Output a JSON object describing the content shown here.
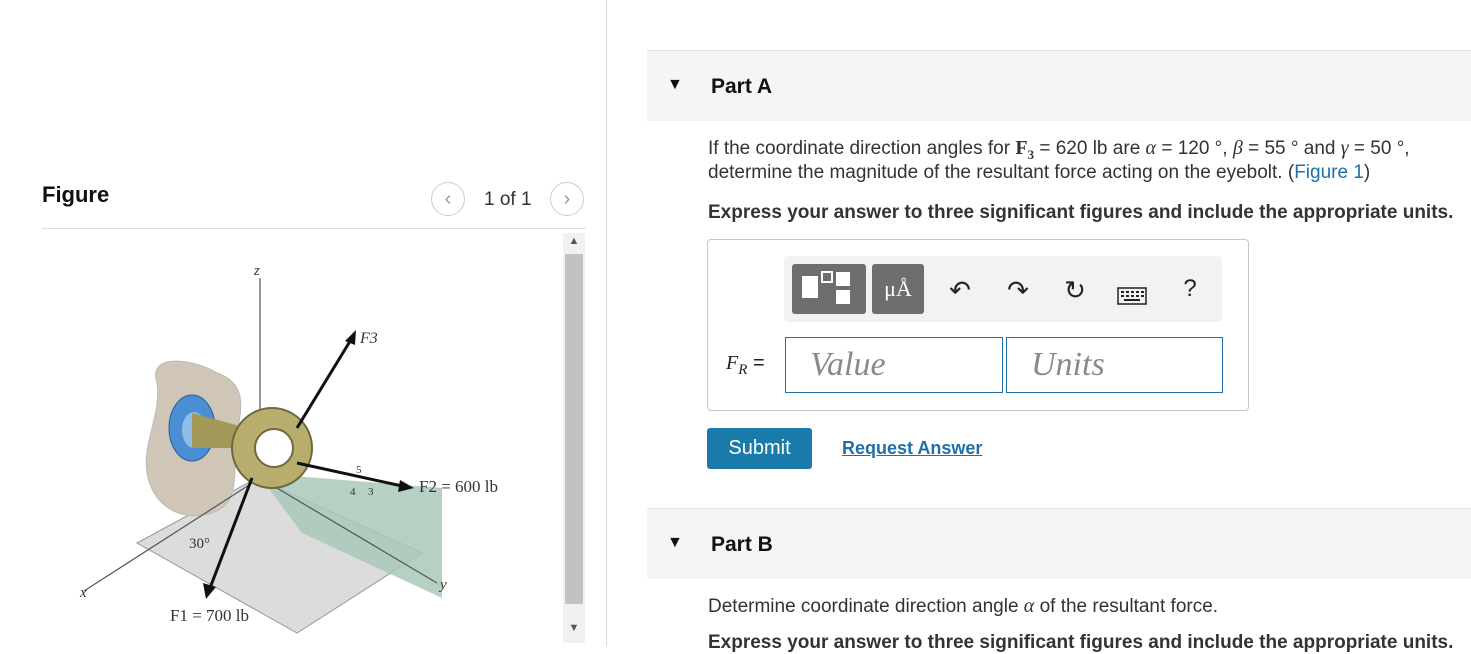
{
  "figure_panel": {
    "title": "Figure",
    "page_indicator": "1 of 1",
    "prev_icon": "chevron-left-icon",
    "next_icon": "chevron-right-icon",
    "diagram": {
      "z_label": "z",
      "x_label": "x",
      "y_label": "y",
      "f3_label": "F3",
      "f2_label": "F2 = 600 lb",
      "f1_label": "F1 = 700 lb",
      "angle_label": "30°",
      "slope_a": "5",
      "slope_b": "4",
      "slope_c": "3"
    }
  },
  "part_a": {
    "title": "Part A",
    "q_prefix": "If the coordinate direction angles for",
    "q_F": "F",
    "q_sub": "3",
    "q_mag": "= 620 lb",
    "q_are": "are",
    "q_alpha": "α",
    "q_alpha_val": "= 120 °,",
    "q_beta": "β",
    "q_beta_val": "= 55 °",
    "q_and": "and",
    "q_gamma": "γ",
    "q_gamma_val": "= 50 °,",
    "q_line2": "determine the magnitude of the resultant force acting on the eyebolt. (",
    "q_link": "Figure 1",
    "q_close": ")",
    "instructions": "Express your answer to three significant figures and include the appropriate units.",
    "toolbar": {
      "units_label": "μÅ",
      "undo_icon": "undo-icon",
      "redo_icon": "redo-icon",
      "reset_icon": "reset-icon",
      "keyboard_icon": "keyboard-icon",
      "help_label": "?"
    },
    "answer_label_var": "F",
    "answer_label_sub": "R",
    "answer_label_eq": "=",
    "value_placeholder": "Value",
    "units_placeholder": "Units",
    "submit_label": "Submit",
    "request_label": "Request Answer"
  },
  "part_b": {
    "title": "Part B",
    "q_prefix": "Determine coordinate direction angle",
    "q_alpha": "α",
    "q_suffix": "of the resultant force.",
    "instructions": "Express your answer to three significant figures and include the appropriate units."
  },
  "colors": {
    "accent": "#1a7bab",
    "link": "#1f6fa8"
  }
}
